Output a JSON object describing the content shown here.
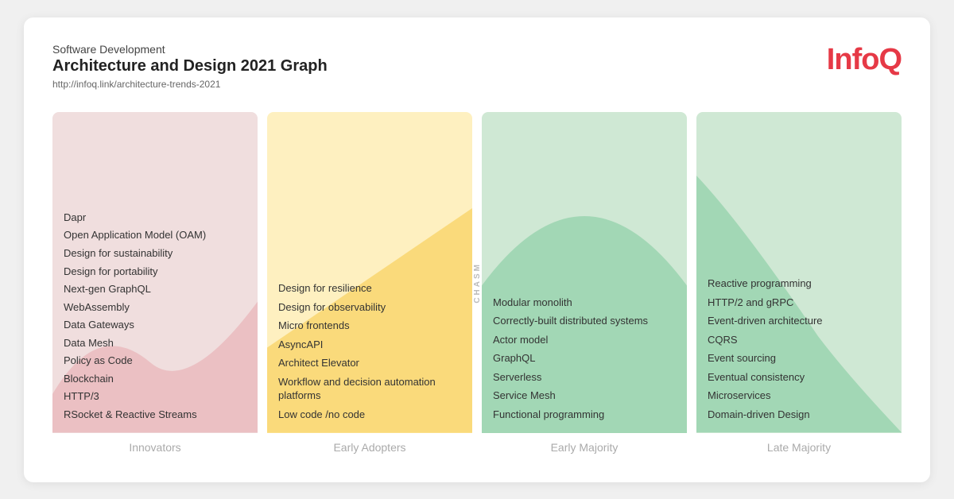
{
  "header": {
    "subtitle": "Software Development",
    "title": "Architecture and Design 2021 Graph",
    "link": "http://infoq.link/architecture-trends-2021",
    "logo_text": "Info",
    "logo_q": "Q"
  },
  "columns": [
    {
      "id": "innovators",
      "label": "Innovators",
      "bg_class": "innovators-bg",
      "items": [
        "Dapr",
        "Open Application Model (OAM)",
        "Design for sustainability",
        "Design for portability",
        "Next-gen GraphQL",
        "WebAssembly",
        "Data Gateways",
        "Data Mesh",
        "Policy as Code",
        "Blockchain",
        "HTTP/3",
        "RSocket & Reactive Streams"
      ]
    },
    {
      "id": "early-adopters",
      "label": "Early Adopters",
      "bg_class": "early-adopters-bg",
      "items": [
        "Design for resilience",
        "Design for observability",
        "Micro frontends",
        "AsyncAPI",
        "Architect Elevator",
        "Workflow and decision automation platforms",
        "Low code /no code"
      ]
    },
    {
      "id": "early-majority",
      "label": "Early Majority",
      "bg_class": "early-majority-bg",
      "items": [
        "Modular monolith",
        "Correctly-built distributed systems",
        "Actor model",
        "GraphQL",
        "Serverless",
        "Service Mesh",
        "Functional programming"
      ]
    },
    {
      "id": "late-majority",
      "label": "Late Majority",
      "bg_class": "late-majority-bg",
      "items": [
        "Reactive programming",
        "HTTP/2 and gRPC",
        "Event-driven architecture",
        "CQRS",
        "Event sourcing",
        "Eventual consistency",
        "Microservices",
        "Domain-driven Design"
      ]
    }
  ],
  "chasm_label": "CHASM"
}
